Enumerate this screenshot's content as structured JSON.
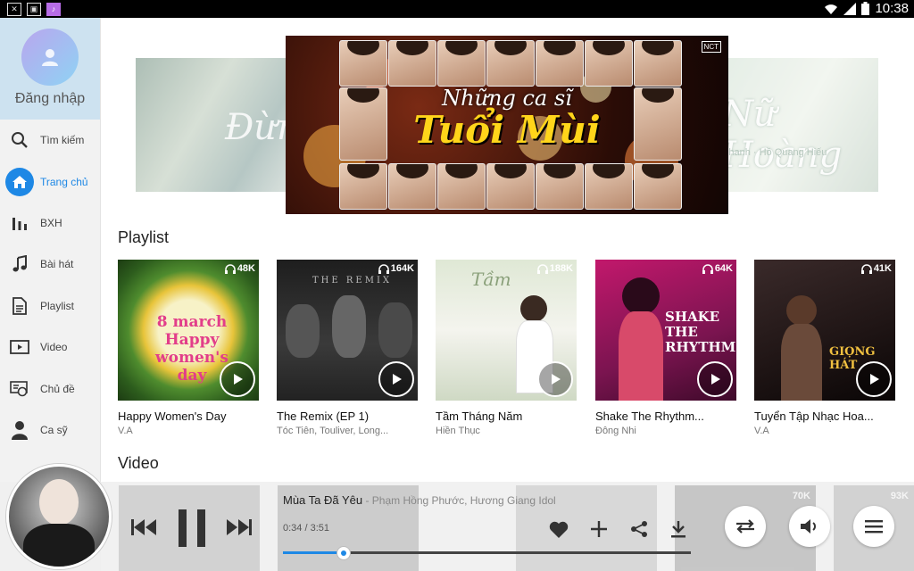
{
  "status_bar": {
    "time": "10:38",
    "notification_icons": [
      "close-icon",
      "image-icon",
      "app-icon"
    ],
    "system_icons": [
      "wifi-icon",
      "signal-icon",
      "battery-icon"
    ]
  },
  "sidebar": {
    "login_label": "Đăng nhập",
    "items": [
      {
        "label": "Tìm kiếm",
        "icon": "search-icon",
        "active": false
      },
      {
        "label": "Trang chủ",
        "icon": "home-icon",
        "active": true
      },
      {
        "label": "BXH",
        "icon": "chart-icon",
        "active": false
      },
      {
        "label": "Bài hát",
        "icon": "music-note-icon",
        "active": false
      },
      {
        "label": "Playlist",
        "icon": "document-icon",
        "active": false
      },
      {
        "label": "Video",
        "icon": "video-icon",
        "active": false
      },
      {
        "label": "Chủ đề",
        "icon": "topic-icon",
        "active": false
      },
      {
        "label": "Ca sỹ",
        "icon": "person-icon",
        "active": false
      }
    ],
    "active_color": "#1e88e5"
  },
  "banner": {
    "center_line1": "Những ca sĩ",
    "center_line2": "Tuổi Mùi",
    "badge": "NCT",
    "right_title": "Nữ Hoàng",
    "right_subtitle": "Khanh · Hồ Quang Hiếu",
    "left_title": "Đừng"
  },
  "sections": {
    "playlist_title": "Playlist",
    "video_title": "Video"
  },
  "playlists": [
    {
      "name": "Happy Women's Day",
      "artist": "V.A",
      "listens": "48K",
      "art_text": "8 march Happy women's day"
    },
    {
      "name": "The Remix (EP 1)",
      "artist": "Tóc Tiên, Touliver, Long...",
      "listens": "164K",
      "art_text": "THE REMIX"
    },
    {
      "name": "Tầm Tháng Năm",
      "artist": "Hiền Thục",
      "listens": "188K",
      "art_text": "Tầm"
    },
    {
      "name": "Shake The Rhythm...",
      "artist": "Đông Nhi",
      "listens": "64K",
      "art_text": "SHAKE THE RHYTHM"
    },
    {
      "name": "Tuyển Tập Nhạc Hoa...",
      "artist": "V.A",
      "listens": "41K",
      "art_text": "GIỌNG HÁT"
    }
  ],
  "player": {
    "song_title": "Mùa Ta Đã Yêu",
    "song_artist": " - Phạm Hồng Phước, Hương Giang Idol",
    "elapsed": "0:34",
    "duration": "3:51",
    "time_text": "0:34 / 3:51",
    "progress_fraction": 0.1472,
    "background_counts": [
      "70K",
      "93K"
    ]
  }
}
